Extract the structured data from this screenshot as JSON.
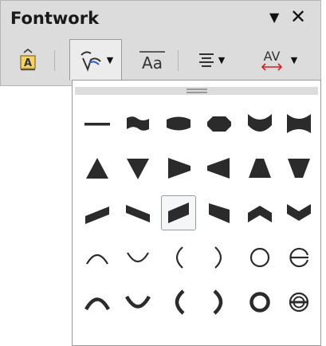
{
  "window": {
    "title": "Fontwork"
  },
  "titlebar": {
    "menu_icon": "dropdown-arrow-icon",
    "close_icon": "close-icon"
  },
  "toolbar": {
    "buttons": [
      {
        "name": "fontwork-gallery",
        "icon": "fontwork-gallery-icon"
      },
      {
        "name": "fontwork-shape",
        "icon": "fontwork-shape-icon",
        "has_dropdown": true,
        "active": true
      },
      {
        "name": "fontwork-same-letter-heights",
        "icon": "same-letter-heights-icon",
        "label": "Aa"
      },
      {
        "name": "fontwork-alignment",
        "icon": "alignment-icon",
        "has_dropdown": true
      },
      {
        "name": "fontwork-character-spacing",
        "icon": "character-spacing-icon",
        "label": "AV",
        "has_dropdown": true
      }
    ]
  },
  "shape_palette": {
    "selected_index": 14,
    "colors": {
      "shape_fill": "#2b2b2b",
      "selected_bg": "#f4f6f8",
      "toolbar_bg": "#dcdcdc"
    },
    "shapes": [
      "plain-text-icon",
      "wave-icon",
      "inflate-icon",
      "stop-icon",
      "curve-down-icon",
      "curve-up-icon",
      "triangle-up-icon",
      "triangle-down-icon",
      "fade-right-icon",
      "fade-left-icon",
      "fade-up-icon",
      "fade-down-icon",
      "slant-up-icon",
      "slant-down-icon",
      "fade-up-right-icon",
      "fade-up-left-icon",
      "chevron-up-icon",
      "chevron-down-icon",
      "arch-up-curve-icon",
      "arch-down-curve-icon",
      "arch-left-curve-icon",
      "arch-right-curve-icon",
      "circle-curve-icon",
      "open-circle-curve-icon",
      "arch-up-pour-icon",
      "arch-down-pour-icon",
      "arch-left-pour-icon",
      "arch-right-pour-icon",
      "circle-pour-icon",
      "open-circle-pour-icon"
    ]
  }
}
